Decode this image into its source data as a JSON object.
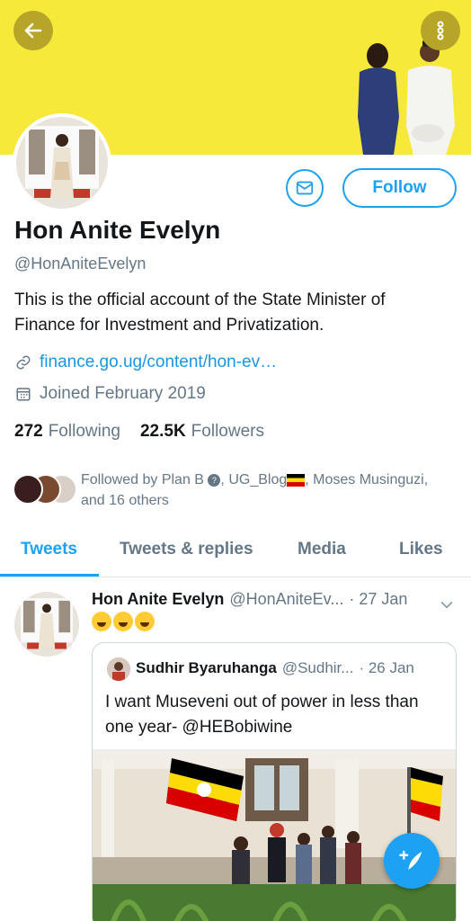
{
  "profile": {
    "name": "Hon Anite Evelyn",
    "handle": "@HonAniteEvelyn",
    "bio": "This is the official account of the State Minister of Finance for Investment and Privatization.",
    "link": "finance.go.ug/content/hon-ev…",
    "joined": "Joined February 2019",
    "following_count": "272",
    "following_label": "Following",
    "followers_count": "22.5K",
    "followers_label": "Followers"
  },
  "actions": {
    "follow_label": "Follow",
    "message_icon": "envelope-icon",
    "back_icon": "arrow-left-icon",
    "more_icon": "more-vertical-icon"
  },
  "followed_by": {
    "prefix": "Followed by Plan B",
    "middle": ", UG_Blog",
    "suffix": ", Moses Musinguzi,",
    "line2": "and 16 others"
  },
  "tabs": [
    {
      "label": "Tweets",
      "active": true
    },
    {
      "label": "Tweets & replies",
      "active": false
    },
    {
      "label": "Media",
      "active": false
    },
    {
      "label": "Likes",
      "active": false
    }
  ],
  "tweet": {
    "author_name": "Hon Anite Evelyn",
    "author_handle": "@HonAniteEv...",
    "date": "· 27 Jan",
    "emoji": "face-with-tears-of-joy x3",
    "quote": {
      "author_name": "Sudhir Byaruhanga",
      "author_handle": "@Sudhir...",
      "date": "· 26 Jan",
      "text": "I want Museveni out of power in less than one year- @HEBobiwine"
    }
  },
  "colors": {
    "accent": "#1da1f2",
    "banner": "#f7e93a",
    "link": "#1b95e0",
    "muted": "#657786"
  }
}
